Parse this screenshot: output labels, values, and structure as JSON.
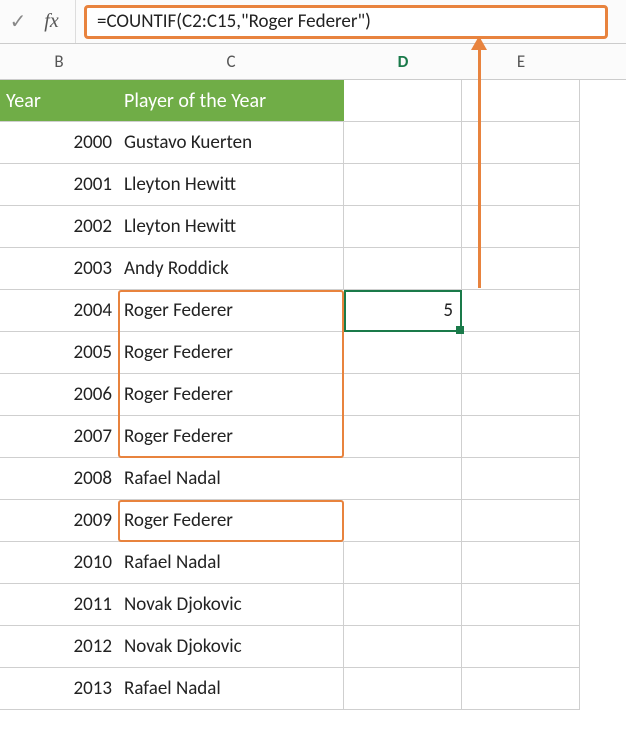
{
  "formula_bar": {
    "fx_label": "fx",
    "formula": "=COUNTIF(C2:C15,\"Roger Federer\")"
  },
  "columns": {
    "B": "B",
    "C": "C",
    "D": "D",
    "E": "E"
  },
  "headers": {
    "year": "Year",
    "player": "Player of the Year"
  },
  "result": {
    "value": "5"
  },
  "rows": [
    {
      "year": "2000",
      "player": "Gustavo Kuerten"
    },
    {
      "year": "2001",
      "player": "Lleyton Hewitt"
    },
    {
      "year": "2002",
      "player": "Lleyton Hewitt"
    },
    {
      "year": "2003",
      "player": "Andy Roddick"
    },
    {
      "year": "2004",
      "player": "Roger Federer"
    },
    {
      "year": "2005",
      "player": "Roger Federer"
    },
    {
      "year": "2006",
      "player": "Roger Federer"
    },
    {
      "year": "2007",
      "player": "Roger Federer"
    },
    {
      "year": "2008",
      "player": "Rafael Nadal"
    },
    {
      "year": "2009",
      "player": "Roger Federer"
    },
    {
      "year": "2010",
      "player": "Rafael Nadal"
    },
    {
      "year": "2011",
      "player": "Novak Djokovic"
    },
    {
      "year": "2012",
      "player": "Novak Djokovic"
    },
    {
      "year": "2013",
      "player": "Rafael Nadal"
    }
  ],
  "chart_data": {
    "type": "table",
    "title": "Player of the Year",
    "columns": [
      "Year",
      "Player of the Year"
    ],
    "rows": [
      [
        2000,
        "Gustavo Kuerten"
      ],
      [
        2001,
        "Lleyton Hewitt"
      ],
      [
        2002,
        "Lleyton Hewitt"
      ],
      [
        2003,
        "Andy Roddick"
      ],
      [
        2004,
        "Roger Federer"
      ],
      [
        2005,
        "Roger Federer"
      ],
      [
        2006,
        "Roger Federer"
      ],
      [
        2007,
        "Roger Federer"
      ],
      [
        2008,
        "Rafael Nadal"
      ],
      [
        2009,
        "Roger Federer"
      ],
      [
        2010,
        "Rafael Nadal"
      ],
      [
        2011,
        "Novak Djokovic"
      ],
      [
        2012,
        "Novak Djokovic"
      ],
      [
        2013,
        "Rafael Nadal"
      ]
    ],
    "countif_result": 5,
    "countif_target": "Roger Federer"
  }
}
